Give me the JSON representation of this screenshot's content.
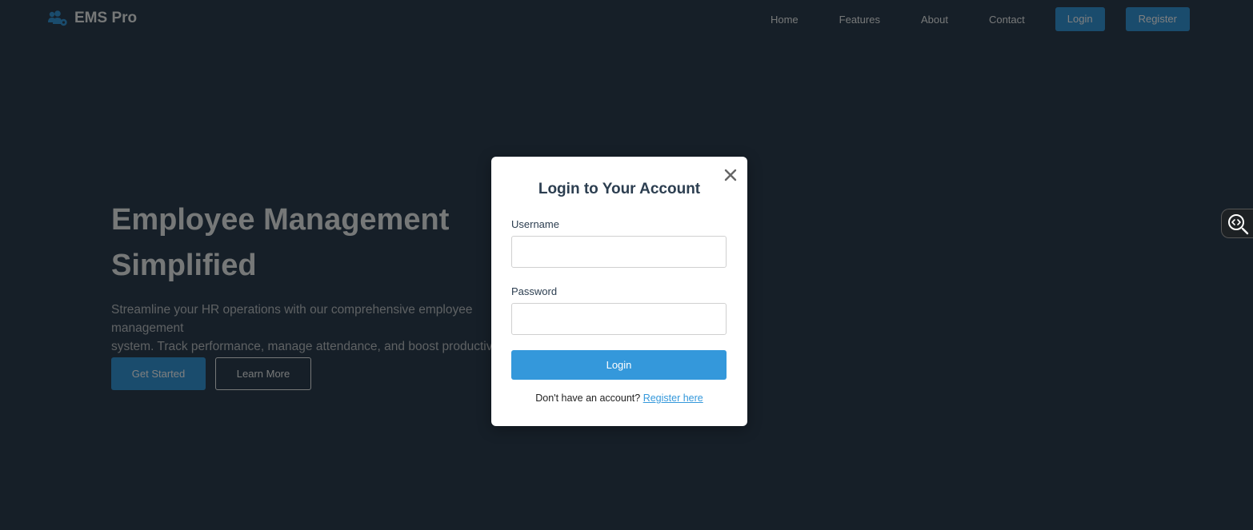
{
  "navbar": {
    "brand": "EMS Pro",
    "links": [
      "Home",
      "Features",
      "About",
      "Contact"
    ],
    "login_label": "Login",
    "register_label": "Register"
  },
  "hero": {
    "title_line1": "Employee Management",
    "title_line2": "Simplified",
    "subtitle_line1": "Streamline your HR operations with our comprehensive employee management",
    "subtitle_line2": "system. Track performance, manage attendance, and boost productivity.",
    "get_started_label": "Get Started",
    "learn_more_label": "Learn More"
  },
  "modal": {
    "title": "Login to Your Account",
    "username_label": "Username",
    "username_value": "",
    "password_label": "Password",
    "password_value": "",
    "login_label": "Login",
    "footer_text": "Don't have an account?",
    "register_link": "Register here"
  },
  "colors": {
    "navbar_bg": "#2c3e50",
    "page_bg": "#2c3e50",
    "accent": "#3498db",
    "modal_bg": "#ffffff"
  },
  "icons": {
    "brand": "users-cog-icon",
    "close": "close-icon",
    "side_tool": "code-search-icon"
  }
}
